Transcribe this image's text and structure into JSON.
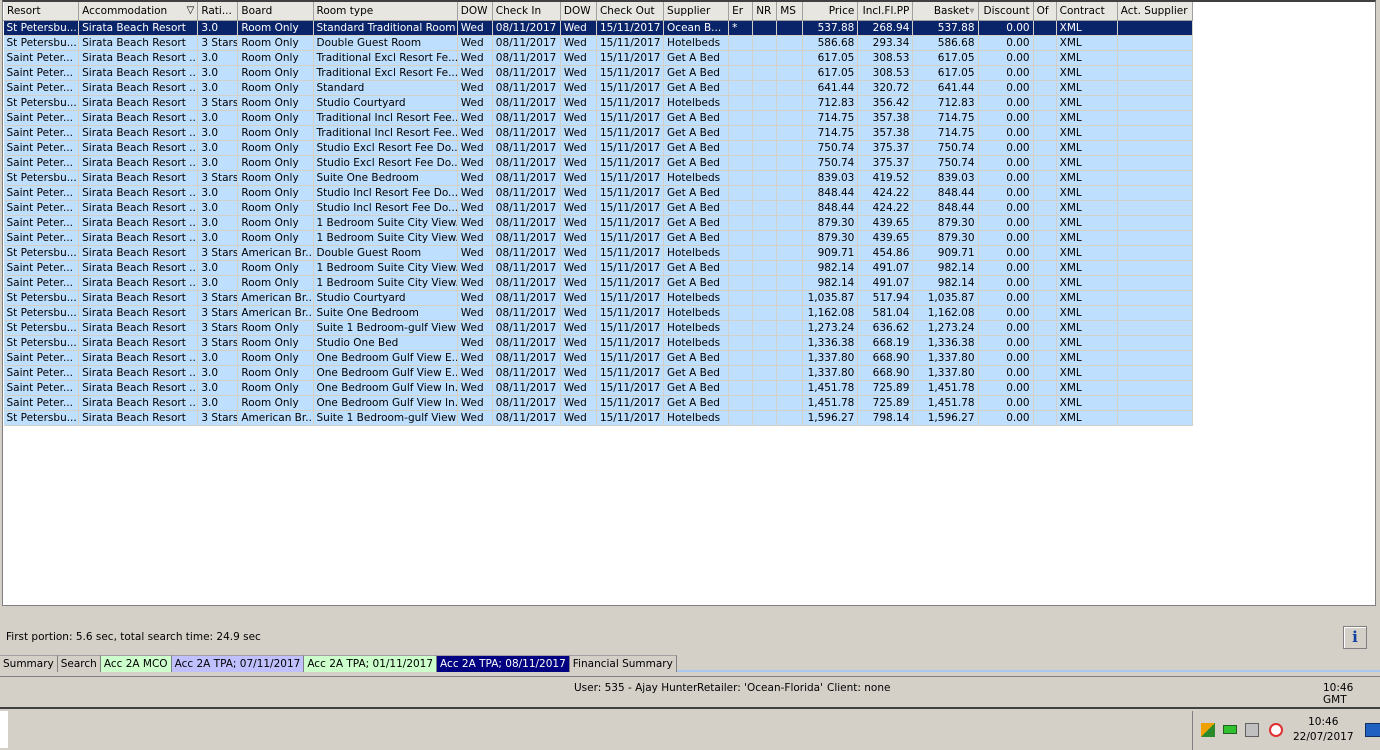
{
  "columns": [
    "Resort",
    "Accommodation",
    "Rati...",
    "Board",
    "Room type",
    "DOW",
    "Check In",
    "DOW",
    "Check Out",
    "Supplier",
    "Er",
    "NR",
    "MS",
    "Price",
    "Incl.Fl.PP",
    "Basket",
    "Discount",
    "Of",
    "Contract",
    "Act. Supplier"
  ],
  "rows": [
    [
      "St Petersbu...",
      "Sirata Beach Resort",
      "3.0",
      "Room Only",
      "Standard Traditional Room",
      "Wed",
      "08/11/2017",
      "Wed",
      "15/11/2017",
      "Ocean B...",
      "*",
      "",
      "",
      "537.88",
      "268.94",
      "537.88",
      "0.00",
      "",
      "XML",
      ""
    ],
    [
      "St Petersbu...",
      "Sirata Beach Resort",
      "3 Stars",
      "Room Only",
      "Double Guest Room",
      "Wed",
      "08/11/2017",
      "Wed",
      "15/11/2017",
      "Hotelbeds",
      "",
      "",
      "",
      "586.68",
      "293.34",
      "586.68",
      "0.00",
      "",
      "XML",
      ""
    ],
    [
      "Saint Peter...",
      "Sirata Beach Resort ...",
      "3.0",
      "Room Only",
      "Traditional Excl Resort Fe...",
      "Wed",
      "08/11/2017",
      "Wed",
      "15/11/2017",
      "Get A Bed",
      "",
      "",
      "",
      "617.05",
      "308.53",
      "617.05",
      "0.00",
      "",
      "XML",
      ""
    ],
    [
      "Saint Peter...",
      "Sirata Beach Resort ...",
      "3.0",
      "Room Only",
      "Traditional Excl Resort Fe...",
      "Wed",
      "08/11/2017",
      "Wed",
      "15/11/2017",
      "Get A Bed",
      "",
      "",
      "",
      "617.05",
      "308.53",
      "617.05",
      "0.00",
      "",
      "XML",
      ""
    ],
    [
      "Saint Peter...",
      "Sirata Beach Resort ...",
      "3.0",
      "Room Only",
      "Standard",
      "Wed",
      "08/11/2017",
      "Wed",
      "15/11/2017",
      "Get A Bed",
      "",
      "",
      "",
      "641.44",
      "320.72",
      "641.44",
      "0.00",
      "",
      "XML",
      ""
    ],
    [
      "St Petersbu...",
      "Sirata Beach Resort",
      "3 Stars",
      "Room Only",
      "Studio Courtyard",
      "Wed",
      "08/11/2017",
      "Wed",
      "15/11/2017",
      "Hotelbeds",
      "",
      "",
      "",
      "712.83",
      "356.42",
      "712.83",
      "0.00",
      "",
      "XML",
      ""
    ],
    [
      "Saint Peter...",
      "Sirata Beach Resort ...",
      "3.0",
      "Room Only",
      "Traditional Incl Resort Fee...",
      "Wed",
      "08/11/2017",
      "Wed",
      "15/11/2017",
      "Get A Bed",
      "",
      "",
      "",
      "714.75",
      "357.38",
      "714.75",
      "0.00",
      "",
      "XML",
      ""
    ],
    [
      "Saint Peter...",
      "Sirata Beach Resort ...",
      "3.0",
      "Room Only",
      "Traditional Incl Resort Fee...",
      "Wed",
      "08/11/2017",
      "Wed",
      "15/11/2017",
      "Get A Bed",
      "",
      "",
      "",
      "714.75",
      "357.38",
      "714.75",
      "0.00",
      "",
      "XML",
      ""
    ],
    [
      "Saint Peter...",
      "Sirata Beach Resort ...",
      "3.0",
      "Room Only",
      "Studio Excl Resort Fee Do...",
      "Wed",
      "08/11/2017",
      "Wed",
      "15/11/2017",
      "Get A Bed",
      "",
      "",
      "",
      "750.74",
      "375.37",
      "750.74",
      "0.00",
      "",
      "XML",
      ""
    ],
    [
      "Saint Peter...",
      "Sirata Beach Resort ...",
      "3.0",
      "Room Only",
      "Studio Excl Resort Fee Do...",
      "Wed",
      "08/11/2017",
      "Wed",
      "15/11/2017",
      "Get A Bed",
      "",
      "",
      "",
      "750.74",
      "375.37",
      "750.74",
      "0.00",
      "",
      "XML",
      ""
    ],
    [
      "St Petersbu...",
      "Sirata Beach Resort",
      "3 Stars",
      "Room Only",
      "Suite One Bedroom",
      "Wed",
      "08/11/2017",
      "Wed",
      "15/11/2017",
      "Hotelbeds",
      "",
      "",
      "",
      "839.03",
      "419.52",
      "839.03",
      "0.00",
      "",
      "XML",
      ""
    ],
    [
      "Saint Peter...",
      "Sirata Beach Resort ...",
      "3.0",
      "Room Only",
      "Studio Incl Resort Fee Do...",
      "Wed",
      "08/11/2017",
      "Wed",
      "15/11/2017",
      "Get A Bed",
      "",
      "",
      "",
      "848.44",
      "424.22",
      "848.44",
      "0.00",
      "",
      "XML",
      ""
    ],
    [
      "Saint Peter...",
      "Sirata Beach Resort ...",
      "3.0",
      "Room Only",
      "Studio Incl Resort Fee Do...",
      "Wed",
      "08/11/2017",
      "Wed",
      "15/11/2017",
      "Get A Bed",
      "",
      "",
      "",
      "848.44",
      "424.22",
      "848.44",
      "0.00",
      "",
      "XML",
      ""
    ],
    [
      "Saint Peter...",
      "Sirata Beach Resort ...",
      "3.0",
      "Room Only",
      "1 Bedroom Suite City View...",
      "Wed",
      "08/11/2017",
      "Wed",
      "15/11/2017",
      "Get A Bed",
      "",
      "",
      "",
      "879.30",
      "439.65",
      "879.30",
      "0.00",
      "",
      "XML",
      ""
    ],
    [
      "Saint Peter...",
      "Sirata Beach Resort ...",
      "3.0",
      "Room Only",
      "1 Bedroom Suite City View...",
      "Wed",
      "08/11/2017",
      "Wed",
      "15/11/2017",
      "Get A Bed",
      "",
      "",
      "",
      "879.30",
      "439.65",
      "879.30",
      "0.00",
      "",
      "XML",
      ""
    ],
    [
      "St Petersbu...",
      "Sirata Beach Resort",
      "3 Stars",
      "American Br...",
      "Double Guest Room",
      "Wed",
      "08/11/2017",
      "Wed",
      "15/11/2017",
      "Hotelbeds",
      "",
      "",
      "",
      "909.71",
      "454.86",
      "909.71",
      "0.00",
      "",
      "XML",
      ""
    ],
    [
      "Saint Peter...",
      "Sirata Beach Resort ...",
      "3.0",
      "Room Only",
      "1 Bedroom Suite City View...",
      "Wed",
      "08/11/2017",
      "Wed",
      "15/11/2017",
      "Get A Bed",
      "",
      "",
      "",
      "982.14",
      "491.07",
      "982.14",
      "0.00",
      "",
      "XML",
      ""
    ],
    [
      "Saint Peter...",
      "Sirata Beach Resort ...",
      "3.0",
      "Room Only",
      "1 Bedroom Suite City View...",
      "Wed",
      "08/11/2017",
      "Wed",
      "15/11/2017",
      "Get A Bed",
      "",
      "",
      "",
      "982.14",
      "491.07",
      "982.14",
      "0.00",
      "",
      "XML",
      ""
    ],
    [
      "St Petersbu...",
      "Sirata Beach Resort",
      "3 Stars",
      "American Br...",
      "Studio Courtyard",
      "Wed",
      "08/11/2017",
      "Wed",
      "15/11/2017",
      "Hotelbeds",
      "",
      "",
      "",
      "1,035.87",
      "517.94",
      "1,035.87",
      "0.00",
      "",
      "XML",
      ""
    ],
    [
      "St Petersbu...",
      "Sirata Beach Resort",
      "3 Stars",
      "American Br...",
      "Suite One Bedroom",
      "Wed",
      "08/11/2017",
      "Wed",
      "15/11/2017",
      "Hotelbeds",
      "",
      "",
      "",
      "1,162.08",
      "581.04",
      "1,162.08",
      "0.00",
      "",
      "XML",
      ""
    ],
    [
      "St Petersbu...",
      "Sirata Beach Resort",
      "3 Stars",
      "Room Only",
      "Suite 1 Bedroom-gulf View",
      "Wed",
      "08/11/2017",
      "Wed",
      "15/11/2017",
      "Hotelbeds",
      "",
      "",
      "",
      "1,273.24",
      "636.62",
      "1,273.24",
      "0.00",
      "",
      "XML",
      ""
    ],
    [
      "St Petersbu...",
      "Sirata Beach Resort",
      "3 Stars",
      "Room Only",
      "Studio One Bed",
      "Wed",
      "08/11/2017",
      "Wed",
      "15/11/2017",
      "Hotelbeds",
      "",
      "",
      "",
      "1,336.38",
      "668.19",
      "1,336.38",
      "0.00",
      "",
      "XML",
      ""
    ],
    [
      "Saint Peter...",
      "Sirata Beach Resort ...",
      "3.0",
      "Room Only",
      "One Bedroom Gulf View E...",
      "Wed",
      "08/11/2017",
      "Wed",
      "15/11/2017",
      "Get A Bed",
      "",
      "",
      "",
      "1,337.80",
      "668.90",
      "1,337.80",
      "0.00",
      "",
      "XML",
      ""
    ],
    [
      "Saint Peter...",
      "Sirata Beach Resort ...",
      "3.0",
      "Room Only",
      "One Bedroom Gulf View E...",
      "Wed",
      "08/11/2017",
      "Wed",
      "15/11/2017",
      "Get A Bed",
      "",
      "",
      "",
      "1,337.80",
      "668.90",
      "1,337.80",
      "0.00",
      "",
      "XML",
      ""
    ],
    [
      "Saint Peter...",
      "Sirata Beach Resort ...",
      "3.0",
      "Room Only",
      "One Bedroom Gulf View In...",
      "Wed",
      "08/11/2017",
      "Wed",
      "15/11/2017",
      "Get A Bed",
      "",
      "",
      "",
      "1,451.78",
      "725.89",
      "1,451.78",
      "0.00",
      "",
      "XML",
      ""
    ],
    [
      "Saint Peter...",
      "Sirata Beach Resort ...",
      "3.0",
      "Room Only",
      "One Bedroom Gulf View In...",
      "Wed",
      "08/11/2017",
      "Wed",
      "15/11/2017",
      "Get A Bed",
      "",
      "",
      "",
      "1,451.78",
      "725.89",
      "1,451.78",
      "0.00",
      "",
      "XML",
      ""
    ],
    [
      "St Petersbu...",
      "Sirata Beach Resort",
      "3 Stars",
      "American Br...",
      "Suite 1 Bedroom-gulf View",
      "Wed",
      "08/11/2017",
      "Wed",
      "15/11/2017",
      "Hotelbeds",
      "",
      "",
      "",
      "1,596.27",
      "798.14",
      "1,596.27",
      "0.00",
      "",
      "XML",
      ""
    ]
  ],
  "status_message": "First portion: 5.6 sec, total search time: 24.9 sec",
  "info_button": "i",
  "tabs": [
    {
      "label": "Summary",
      "bg": "#d4d0c8",
      "fg": "#000000"
    },
    {
      "label": "Search",
      "bg": "#d4d0c8",
      "fg": "#000000"
    },
    {
      "label": "Acc 2A MCO",
      "bg": "#ccffcc",
      "fg": "#000000"
    },
    {
      "label": "Acc 2A TPA; 07/11/2017",
      "bg": "#c0c0ff",
      "fg": "#000000"
    },
    {
      "label": "Acc 2A TPA; 01/11/2017",
      "bg": "#ccffcc",
      "fg": "#000000"
    },
    {
      "label": "Acc 2A TPA; 08/11/2017",
      "bg": "#000080",
      "fg": "#ffffff"
    },
    {
      "label": "Financial Summary",
      "bg": "#d4d0c8",
      "fg": "#000000"
    }
  ],
  "statusbar": {
    "user": "User: 535 - Ajay Hunter",
    "retailer": "Retailer: 'Ocean-Florida'",
    "client": "Client: none",
    "time": "10:46 GMT"
  },
  "taskbar": {
    "time": "10:46",
    "date": "22/07/2017"
  }
}
